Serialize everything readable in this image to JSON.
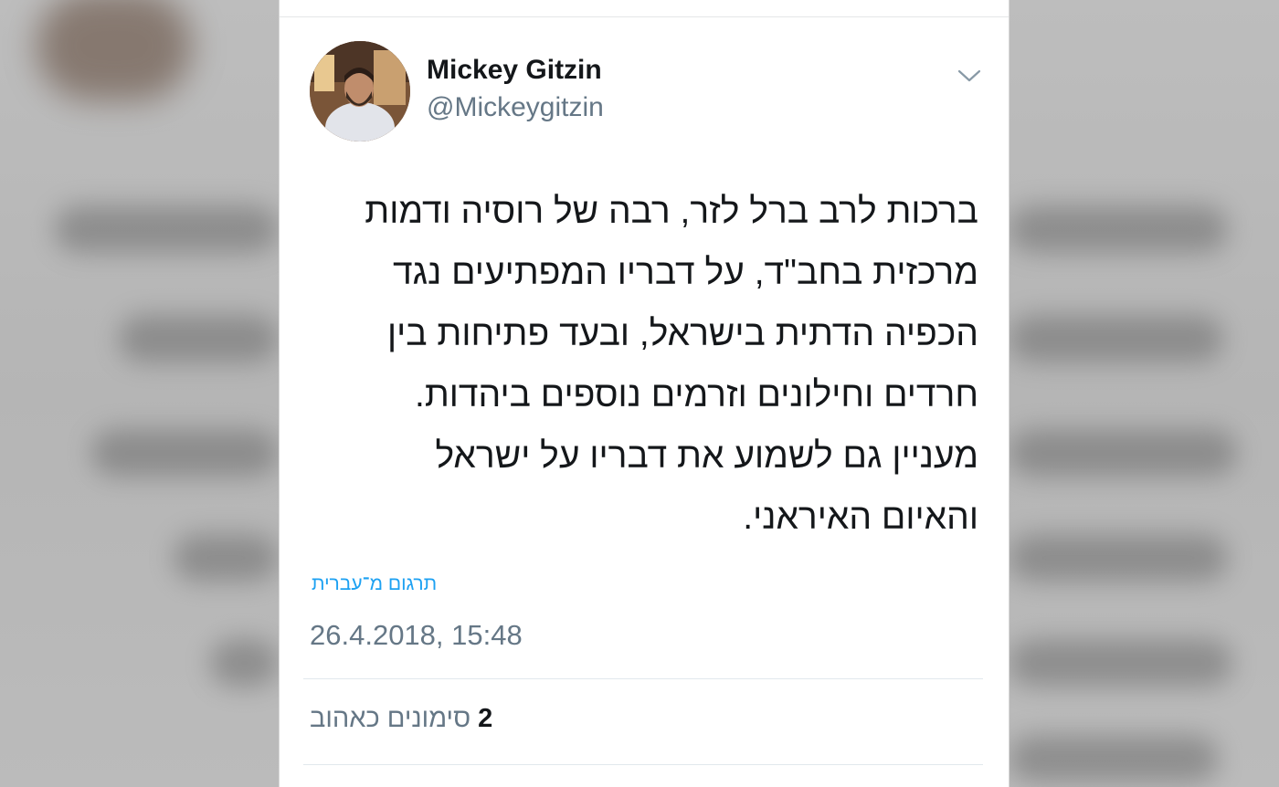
{
  "tweet": {
    "author": {
      "display_name": "Mickey Gitzin",
      "handle": "@Mickeygitzin",
      "avatar_icon": "profile-photo"
    },
    "menu_icon": "chevron-down-icon",
    "text": "ברכות לרב ברל לזר, רבה של רוסיה ודמות\nמרכזית בחב\"ד, על דבריו המפתיעים נגד\nהכפיה הדתית בישראל, ובעד פתיחות בין\nחרדים וחילונים וזרמים נוספים ביהדות.\nמעניין גם לשמוע את דבריו על ישראל\nוהאיום האיראני.",
    "translate_label": "תרגום מ־עברית",
    "timestamp": "26.4.2018, 15:48",
    "likes": {
      "count": "2",
      "label": "סימונים כאהוב"
    }
  },
  "colors": {
    "link": "#1da1f2",
    "secondary_text": "#657786",
    "primary_text": "#14171a",
    "divider": "#e1e8ed"
  }
}
